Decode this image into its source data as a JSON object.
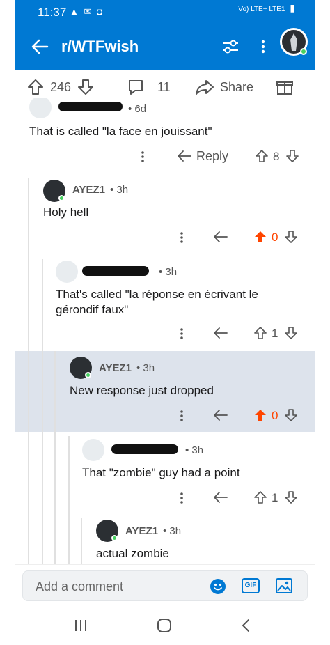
{
  "status": {
    "time": "11:37",
    "network": "Vo) LTE+ LTE1"
  },
  "header": {
    "subreddit": "r/WTFwish"
  },
  "postbar": {
    "upvotes": "246",
    "comments": "11",
    "share": "Share"
  },
  "comments": [
    {
      "age": "• 6d",
      "body": "That is called \"la face en jouissant\"",
      "reply": "Reply",
      "score": "8"
    },
    {
      "user": "AYEZ1",
      "age": "• 3h",
      "body": "Holy hell",
      "score": "0"
    },
    {
      "age": "• 3h",
      "body_line1": "That's called \"la réponse en écrivant le",
      "body_line2": "gérondif faux\"",
      "score": "1"
    },
    {
      "user": "AYEZ1",
      "age": "• 3h",
      "body": "New response just dropped",
      "score": "0"
    },
    {
      "age": "• 3h",
      "body": "That \"zombie\" guy had a point",
      "score": "1"
    },
    {
      "user": "AYEZ1",
      "age": "• 3h",
      "body": "actual zombie"
    }
  ],
  "composer": {
    "placeholder": "Add a comment",
    "gif": "GIF"
  },
  "colors": {
    "brand": "#0079d3",
    "upvote_active": "#ff4500",
    "online": "#46d160"
  }
}
